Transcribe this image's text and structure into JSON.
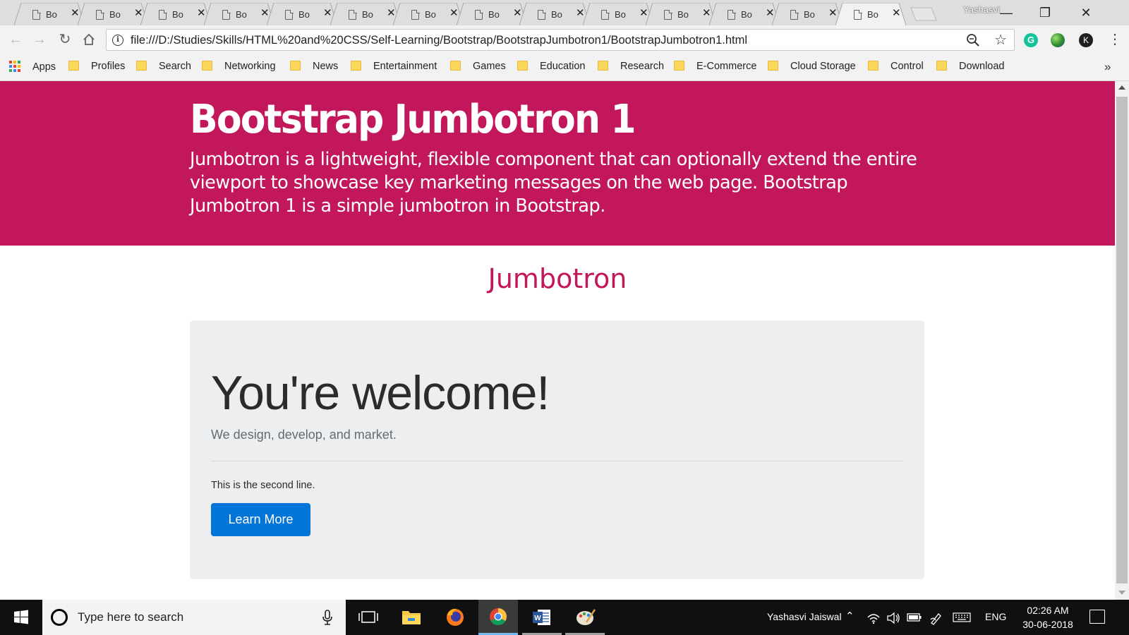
{
  "browser": {
    "tabs": [
      {
        "title": "Bo",
        "close": "✕"
      },
      {
        "title": "Bo",
        "close": "✕"
      },
      {
        "title": "Bo",
        "close": "✕"
      },
      {
        "title": "Bo",
        "close": "✕"
      },
      {
        "title": "Bo",
        "close": "✕"
      },
      {
        "title": "Bo",
        "close": "✕"
      },
      {
        "title": "Bo",
        "close": "✕"
      },
      {
        "title": "Bo",
        "close": "✕"
      },
      {
        "title": "Bo",
        "close": "✕"
      },
      {
        "title": "Bo",
        "close": "✕"
      },
      {
        "title": "Bo",
        "close": "✕"
      },
      {
        "title": "Bo",
        "close": "✕"
      },
      {
        "title": "Bo",
        "close": "✕"
      },
      {
        "title": "Bo",
        "close": "✕",
        "active": true
      }
    ],
    "profile_name": "Yashasvi",
    "url": "file:///D:/Studies/Skills/HTML%20and%20CSS/Self-Learning/Bootstrap/BootstrapJumbotron1/BootstrapJumbotron1.html",
    "extensions": {
      "grammarly": "G",
      "profile": "K"
    },
    "bookmarks": {
      "apps": "Apps",
      "items": [
        "Profiles",
        "Search",
        "Networking",
        "News",
        "Entertainment",
        "Games",
        "Education",
        "Research",
        "E-Commerce",
        "Cloud Storage",
        "Control",
        "Download"
      ],
      "more": "»"
    }
  },
  "page": {
    "hero": {
      "title": "Bootstrap Jumbotron 1",
      "text": "Jumbotron is a lightweight, flexible component that can optionally extend the entire viewport to showcase key marketing messages on the web page. Bootstrap Jumbotron 1 is a simple jumbotron in Bootstrap.",
      "background": "#c2185b"
    },
    "section_title": "Jumbotron",
    "jumbotron": {
      "heading": "You're welcome!",
      "lead": "We design, develop, and market.",
      "second_line": "This is the second line.",
      "button_label": "Learn More",
      "button_color": "#0275d8"
    }
  },
  "taskbar": {
    "search_placeholder": "Type here to search",
    "user": "Yashasvi Jaiswal",
    "language": "ENG",
    "time": "02:26 AM",
    "date": "30-06-2018"
  }
}
